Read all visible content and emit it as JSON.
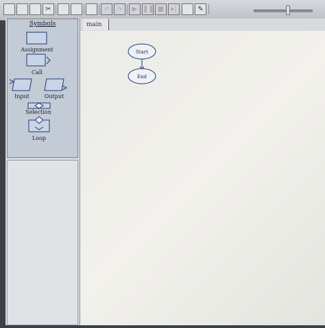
{
  "toolbar": {
    "buttons": [
      {
        "name": "new-file-button",
        "glyph": "",
        "enabled": true
      },
      {
        "name": "open-file-button",
        "glyph": "",
        "enabled": true
      },
      {
        "name": "save-file-button",
        "glyph": "",
        "enabled": true
      },
      {
        "name": "cut-button",
        "glyph": "✂",
        "enabled": true
      },
      {
        "name": "copy-button",
        "glyph": "",
        "enabled": true
      },
      {
        "name": "paste-button",
        "glyph": "",
        "enabled": true
      },
      {
        "name": "print-button",
        "glyph": "",
        "enabled": true
      },
      {
        "name": "undo-button",
        "glyph": "↶",
        "enabled": false
      },
      {
        "name": "redo-button",
        "glyph": "↷",
        "enabled": false
      },
      {
        "name": "run-button",
        "glyph": "▶",
        "enabled": false
      },
      {
        "name": "pause-button",
        "glyph": "❚❚",
        "enabled": false
      },
      {
        "name": "stop-button",
        "glyph": "■",
        "enabled": false
      },
      {
        "name": "step-button",
        "glyph": "▸|",
        "enabled": false
      },
      {
        "name": "graphics-window-button",
        "glyph": "",
        "enabled": true
      },
      {
        "name": "edit-button",
        "glyph": "✎",
        "enabled": true
      }
    ],
    "zoom_level": 0.58
  },
  "palette": {
    "title": "Symbols",
    "symbols": {
      "assignment": "Assignment",
      "call": "Call",
      "input": "Input",
      "output": "Output",
      "selection": "Selection",
      "loop": "Loop"
    }
  },
  "tabs": [
    "main"
  ],
  "flowchart": {
    "start_label": "Start",
    "end_label": "End"
  },
  "colors": {
    "palette_bg": "#c3cbd7",
    "symbol_fill": "#c9d5e6",
    "symbol_stroke": "#1f3a75",
    "canvas_bg": "#eeeeea"
  }
}
